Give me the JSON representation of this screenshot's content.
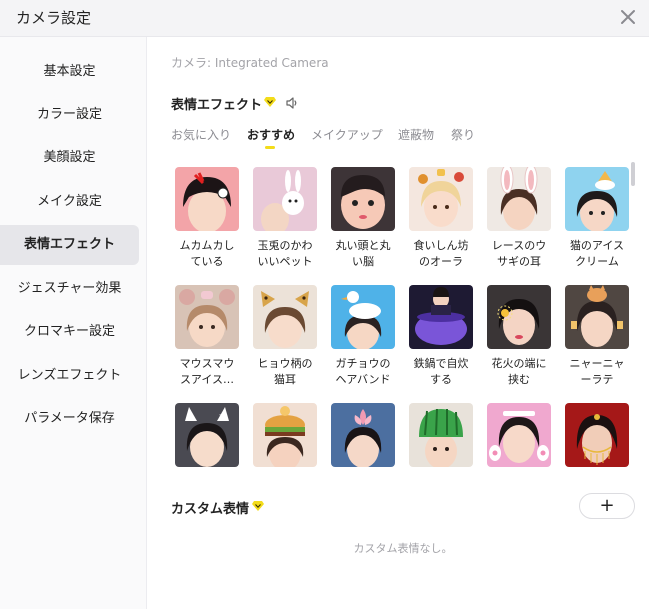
{
  "window": {
    "title": "カメラ設定",
    "close_icon": "close-icon"
  },
  "sidebar": {
    "items": [
      {
        "label": "基本設定"
      },
      {
        "label": "カラー設定"
      },
      {
        "label": "美顔設定"
      },
      {
        "label": "メイク設定"
      },
      {
        "label": "表情エフェクト",
        "active": true
      },
      {
        "label": "ジェスチャー効果"
      },
      {
        "label": "クロマキー設定"
      },
      {
        "label": "レンズエフェクト"
      },
      {
        "label": "パラメータ保存"
      }
    ]
  },
  "main": {
    "camera_label": "カメラ: Integrated Camera",
    "effects_title": "表情エフェクト",
    "tabs": [
      {
        "label": "お気に入り"
      },
      {
        "label": "おすすめ",
        "active": true
      },
      {
        "label": "メイクアップ"
      },
      {
        "label": "遮蔽物"
      },
      {
        "label": "祭り"
      }
    ],
    "effects": [
      {
        "name_line1": "ムカムカし",
        "name_line2": "ている",
        "icon": "angry-face-thumbnail",
        "bg": "#f3a4a8"
      },
      {
        "name_line1": "玉兎のかわ",
        "name_line2": "いいペット",
        "icon": "rabbit-pet-thumbnail",
        "bg": "#e9c9d8"
      },
      {
        "name_line1": "丸い頭と丸",
        "name_line2": "い脳",
        "icon": "round-head-thumbnail",
        "bg": "#3d3437"
      },
      {
        "name_line1": "食いしん坊",
        "name_line2": "のオーラ",
        "icon": "foodie-aura-thumbnail",
        "bg": "#f4e7df"
      },
      {
        "name_line1": "レースのウ",
        "name_line2": "サギの耳",
        "icon": "lace-bunny-ears-thumbnail",
        "bg": "#efe9e4"
      },
      {
        "name_line1": "猫のアイス",
        "name_line2": "クリーム",
        "icon": "cat-ice-cream-thumbnail",
        "bg": "#8fd3ef"
      },
      {
        "name_line1": "マウスマウ",
        "name_line2": "スアイス…",
        "icon": "mouse-ice-thumbnail",
        "bg": "#d8c3b6"
      },
      {
        "name_line1": "ヒョウ柄の",
        "name_line2": "猫耳",
        "icon": "leopard-cat-ears-thumbnail",
        "bg": "#ece2d8"
      },
      {
        "name_line1": "ガチョウの",
        "name_line2": "ヘアバンド",
        "icon": "goose-headband-thumbnail",
        "bg": "#4fb2e8"
      },
      {
        "name_line1": "鉄鍋で自炊",
        "name_line2": "する",
        "icon": "iron-pot-thumbnail",
        "bg": "#6e4fd0"
      },
      {
        "name_line1": "花火の端に",
        "name_line2": "挟む",
        "icon": "fireworks-clip-thumbnail",
        "bg": "#3a3536"
      },
      {
        "name_line1": "ニャーニャ",
        "name_line2": "ーラテ",
        "icon": "meow-latte-thumbnail",
        "bg": "#504742"
      },
      {
        "name_line1": "",
        "name_line2": "",
        "icon": "cat-ears-sleepy-thumbnail",
        "bg": "#4a4a52"
      },
      {
        "name_line1": "",
        "name_line2": "",
        "icon": "burger-hat-thumbnail",
        "bg": "#f1dfd3"
      },
      {
        "name_line1": "",
        "name_line2": "",
        "icon": "lotus-headpiece-thumbnail",
        "bg": "#4c6fa0"
      },
      {
        "name_line1": "",
        "name_line2": "",
        "icon": "watermelon-helmet-thumbnail",
        "bg": "#e8e2da"
      },
      {
        "name_line1": "",
        "name_line2": "",
        "icon": "cat-paws-thumbnail",
        "bg": "#f0a8cf"
      },
      {
        "name_line1": "",
        "name_line2": "",
        "icon": "golden-veil-thumbnail",
        "bg": "#a51818"
      }
    ],
    "custom_title": "カスタム表情",
    "add_button_label": "+",
    "custom_empty": "カスタム表情なし。"
  },
  "colors": {
    "accent": "#f3dc1a",
    "active_bg": "#e6e6ea",
    "muted_text": "#a3a3a8"
  }
}
